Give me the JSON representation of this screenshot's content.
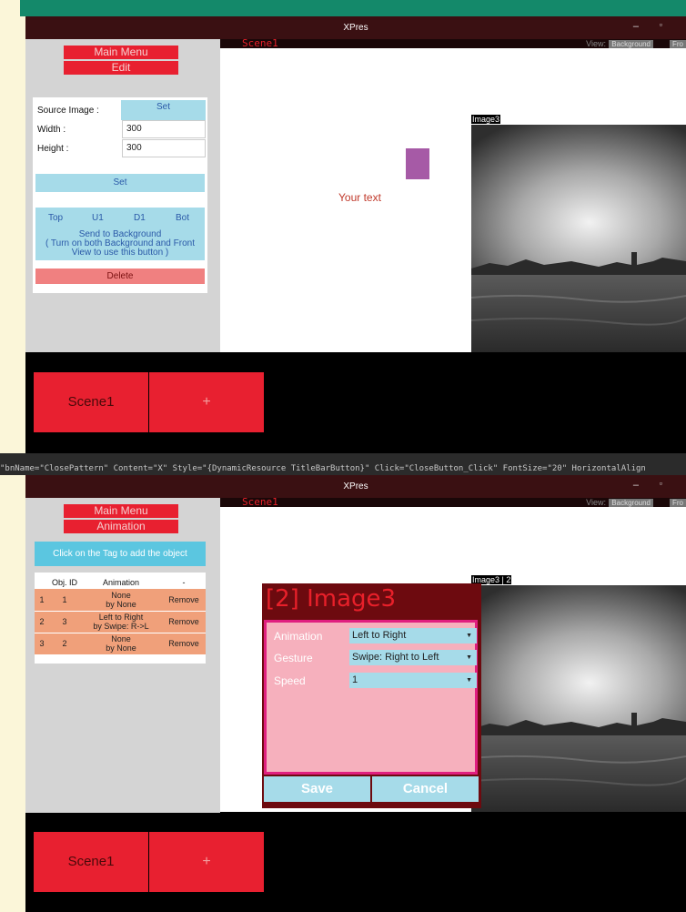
{
  "app_title": "XPres",
  "window_controls": {
    "minimize": "–",
    "maximize": "▫"
  },
  "view_label": "View:",
  "view_buttons": [
    "Background",
    "Fro"
  ],
  "code_snippet": "\"bnName=\"ClosePattern\" Content=\"X\" Style=\"{DynamicResource TitleBarButton}\" Click=\"CloseButton_Click\" FontSize=\"20\" HorizontalAlign",
  "top_window": {
    "scene_name": "Scene1",
    "main_menu": "Main Menu",
    "section": "Edit",
    "form": {
      "source_image_label": "Source Image :",
      "source_image_button": "Set",
      "width_label": "Width :",
      "width_value": "300",
      "height_label": "Height :",
      "height_value": "300",
      "set_button": "Set",
      "order_buttons": [
        "Top",
        "U1",
        "D1",
        "Bot"
      ],
      "send_bg_text": "Send to Background",
      "send_bg_note": "( Turn on both Background and Front View to use this button )",
      "delete_button": "Delete"
    },
    "canvas": {
      "text_object": "Your text",
      "image_label": "Image3",
      "swatch_color": "#a65aa6"
    }
  },
  "bottom_window": {
    "scene_name": "Scene1",
    "main_menu": "Main Menu",
    "section": "Animation",
    "tag_hint": "Click on the Tag to add the object",
    "table": {
      "headers": [
        "",
        "Obj. ID",
        "Animation",
        "-"
      ],
      "rows": [
        {
          "index": "1",
          "obj_id": "1",
          "animation_line1": "None",
          "animation_line2": "by None",
          "action": "Remove"
        },
        {
          "index": "2",
          "obj_id": "3",
          "animation_line1": "Left to Right",
          "animation_line2": "by Swipe: R->L",
          "action": "Remove"
        },
        {
          "index": "3",
          "obj_id": "2",
          "animation_line1": "None",
          "animation_line2": "by None",
          "action": "Remove"
        }
      ]
    },
    "canvas": {
      "image_label": "Image3 | 2"
    },
    "dialog": {
      "title": "[2] Image3",
      "animation_label": "Animation",
      "animation_value": "Left to Right",
      "gesture_label": "Gesture",
      "gesture_value": "Swipe: Right to Left",
      "speed_label": "Speed",
      "speed_value": "1",
      "save_button": "Save",
      "cancel_button": "Cancel"
    }
  },
  "scene_tiles": {
    "scene": "Scene1",
    "add": "+"
  }
}
